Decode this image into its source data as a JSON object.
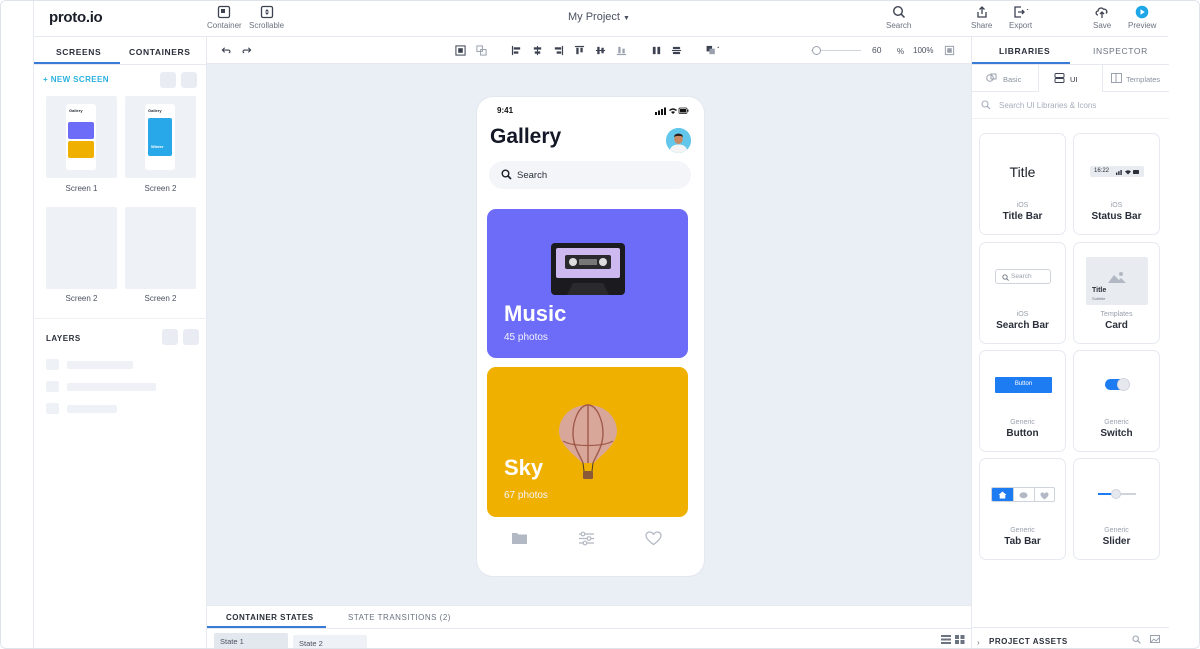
{
  "app": {
    "logo": "proto.io",
    "project": "My Project"
  },
  "toolbar": {
    "container": "Container",
    "scrollable": "Scrollable",
    "search": "Search",
    "share": "Share",
    "export": "Export",
    "save": "Save",
    "preview": "Preview",
    "zoom_value": "60",
    "zoom_unit": "%",
    "zoom_fit": "100%"
  },
  "left": {
    "tab_screens": "SCREENS",
    "tab_containers": "CONTAINERS",
    "new_screen": "+ NEW SCREEN",
    "screens": [
      {
        "label": "Screen 1"
      },
      {
        "label": "Screen 2"
      },
      {
        "label": "Screen 2"
      },
      {
        "label": "Screen 2"
      }
    ],
    "thumb1_title": "Gallery",
    "thumb2_title": "Gallery",
    "thumb2_card": "Winter",
    "layers": "LAYERS"
  },
  "phone": {
    "time": "9:41",
    "title": "Gallery",
    "search_placeholder": "Search",
    "cards": [
      {
        "title": "Music",
        "subtitle": "45 photos",
        "color": "#6c6cf8"
      },
      {
        "title": "Sky",
        "subtitle": "67 photos",
        "color": "#f0b000"
      }
    ]
  },
  "bottom": {
    "tab_states": "CONTAINER STATES",
    "tab_transitions": "STATE TRANSITIONS (2)",
    "state1": "State 1",
    "state2": "State 2"
  },
  "right": {
    "tab_libraries": "LIBRARIES",
    "tab_inspector": "INSPECTOR",
    "sub_basic": "Basic",
    "sub_ui": "UI",
    "sub_templates": "Templates",
    "search_placeholder": "Search UI Libraries & Icons",
    "items": [
      {
        "category": "iOS",
        "name": "Title Bar",
        "preview": "Title"
      },
      {
        "category": "iOS",
        "name": "Status Bar",
        "preview": "16:22"
      },
      {
        "category": "iOS",
        "name": "Search Bar",
        "preview": "Search"
      },
      {
        "category": "Templates",
        "name": "Card",
        "preview": "Title",
        "preview_sub": "Subtitle"
      },
      {
        "category": "Generic",
        "name": "Button",
        "preview": "Button"
      },
      {
        "category": "Generic",
        "name": "Switch"
      },
      {
        "category": "Generic",
        "name": "Tab Bar"
      },
      {
        "category": "Generic",
        "name": "Slider"
      }
    ],
    "project_assets": "PROJECT ASSETS"
  },
  "colors": {
    "accent": "#3a7bd5",
    "brand_cyan": "#2bb1e0",
    "music": "#6c6cf8",
    "sky": "#f0b000",
    "ios_blue": "#1e7cf2"
  }
}
